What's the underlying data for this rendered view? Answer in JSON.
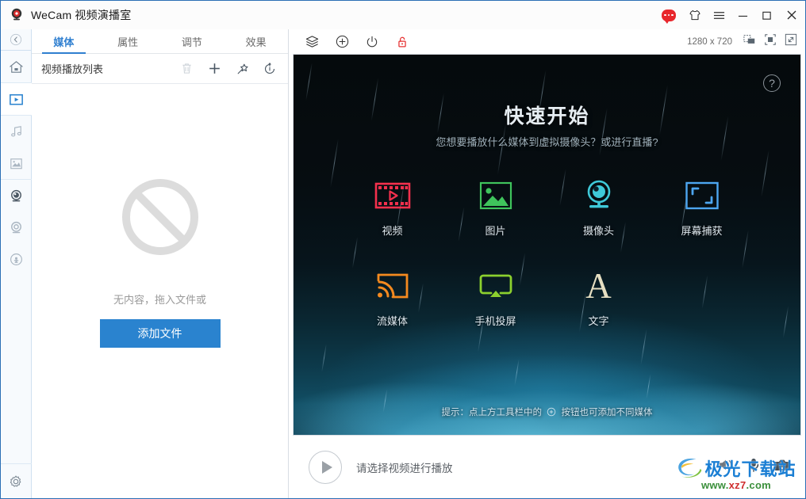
{
  "window": {
    "title": "WeCam 视频演播室",
    "logo_icon": "webcam-logo-icon",
    "controls": [
      {
        "name": "feedback-icon",
        "label": ""
      },
      {
        "name": "skin-theme-icon",
        "label": ""
      },
      {
        "name": "menu-icon",
        "label": ""
      },
      {
        "name": "minimize-icon",
        "label": ""
      },
      {
        "name": "maximize-icon",
        "label": ""
      },
      {
        "name": "close-icon",
        "label": ""
      }
    ]
  },
  "rail": {
    "collapse_icon": "chevron-left-circle-icon",
    "items": [
      {
        "name": "sidebar-item-home",
        "icon": "home-icon",
        "active": false
      },
      {
        "name": "sidebar-item-video",
        "icon": "video-play-icon",
        "active": true
      },
      {
        "name": "sidebar-item-music",
        "icon": "music-note-icon",
        "active": false
      },
      {
        "name": "sidebar-item-image",
        "icon": "picture-icon",
        "active": false
      },
      {
        "name": "sidebar-item-camera",
        "icon": "webcam-icon",
        "active": false
      },
      {
        "name": "sidebar-item-virtual-cam",
        "icon": "circle-camera-icon",
        "active": false
      },
      {
        "name": "sidebar-item-broadcast",
        "icon": "broadcast-icon",
        "active": false
      }
    ],
    "settings_icon": "gear-icon"
  },
  "panel": {
    "tabs": [
      {
        "label": "媒体",
        "active": true
      },
      {
        "label": "属性",
        "active": false
      },
      {
        "label": "调节",
        "active": false
      },
      {
        "label": "效果",
        "active": false
      }
    ],
    "playlist_title": "视频播放列表",
    "actions": [
      {
        "name": "delete-button",
        "icon": "trash-icon",
        "disabled": true
      },
      {
        "name": "add-button",
        "icon": "plus-icon",
        "disabled": false
      },
      {
        "name": "pin-button",
        "icon": "pin-star-icon",
        "disabled": false
      },
      {
        "name": "loop-button",
        "icon": "loop-icon",
        "disabled": false
      }
    ],
    "empty_icon": "no-entry-icon",
    "empty_text": "无内容，拖入文件或",
    "add_file_label": "添加文件"
  },
  "toolbar": {
    "icons": [
      {
        "name": "layers-icon"
      },
      {
        "name": "add-circle-icon"
      },
      {
        "name": "power-icon"
      },
      {
        "name": "unlock-icon"
      }
    ],
    "resolution": "1280 x 720",
    "right_icons": [
      {
        "name": "snapshot-icon"
      },
      {
        "name": "crop-icon"
      },
      {
        "name": "fullscreen-icon"
      }
    ]
  },
  "preview": {
    "help_icon": "help-circle-icon",
    "help_label": "?",
    "quick_start_title": "快速开始",
    "quick_start_subtitle": "您想要播放什么媒体到虚拟摄像头？或进行直播?",
    "tiles_row1": [
      {
        "label": "视频",
        "icon": "film-strip-icon",
        "color": "#f4304d"
      },
      {
        "label": "图片",
        "icon": "picture-icon",
        "color": "#3fc45c"
      },
      {
        "label": "摄像头",
        "icon": "webcam-icon",
        "color": "#3fc9d8"
      },
      {
        "label": "屏幕捕获",
        "icon": "screen-capture-icon",
        "color": "#4da6f0"
      }
    ],
    "tiles_row2": [
      {
        "label": "流媒体",
        "icon": "cast-stream-icon",
        "color": "#f58a1f"
      },
      {
        "label": "手机投屏",
        "icon": "airplay-icon",
        "color": "#8cd02e"
      },
      {
        "label": "文字",
        "icon": "text-a-icon",
        "color": "#e6dfc2"
      }
    ],
    "hint_before": "提示：点上方工具栏中的",
    "hint_icon": "add-circle-icon",
    "hint_after": "按钮也可添加不同媒体"
  },
  "player": {
    "play_icon": "play-icon",
    "status_text": "请选择视频进行播放",
    "volume_icon": "speaker-icon",
    "mic_icon": "microphone-icon",
    "camera_icon": "camera-icon"
  },
  "watermark": {
    "brand": "极光下载站",
    "url_prefix": "www.",
    "url_mid": "xz7",
    "url_suffix": ".com"
  },
  "colors": {
    "accent": "#2a83cf",
    "tab_active": "#2f7fd0",
    "window_border": "#2b6fb5",
    "alert_red": "#e8272c"
  }
}
